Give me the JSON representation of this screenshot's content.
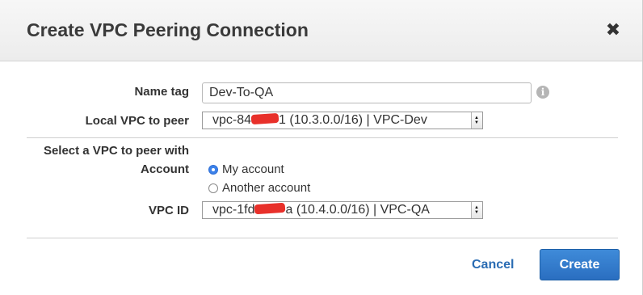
{
  "dialog": {
    "title": "Create VPC Peering Connection",
    "close_glyph": "✖"
  },
  "form": {
    "name_tag": {
      "label": "Name tag",
      "value": "Dev-To-QA",
      "info_icon": "info-icon",
      "info_glyph": "i"
    },
    "local_vpc": {
      "label": "Local VPC to peer",
      "value_prefix": "vpc-84",
      "value_suffix": "1 (10.3.0.0/16) | VPC-Dev"
    },
    "peer_section": {
      "heading": "Select a VPC to peer with",
      "account_label": "Account",
      "account_options": [
        {
          "label": "My account",
          "selected": true
        },
        {
          "label": "Another account",
          "selected": false
        }
      ],
      "vpc_id_label": "VPC ID",
      "vpc_id_value_prefix": "vpc-1fd",
      "vpc_id_value_suffix": "a (10.4.0.0/16) | VPC-QA"
    }
  },
  "footer": {
    "cancel_label": "Cancel",
    "create_label": "Create"
  },
  "colors": {
    "primary_button": "#2a6ec0",
    "link": "#2a6cb3",
    "radio_selected": "#3d82ea",
    "redaction": "#e8302a"
  }
}
